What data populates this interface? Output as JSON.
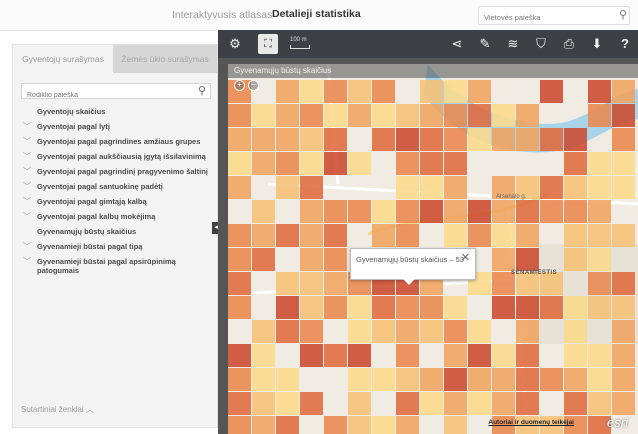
{
  "topbar": {
    "nav_atlas": "Interaktyvusis atlasas",
    "nav_stats": "Detalieji statistika",
    "search_placeholder": "Vietovės paieška"
  },
  "left_panel": {
    "tab_population": "Gyventojų surašymas",
    "tab_agriculture": "Žemės ūkio surašymas",
    "search_placeholder": "Rodiklio paieška",
    "items": [
      {
        "label": "Gyventojų skaičius",
        "expandable": false
      },
      {
        "label": "Gyventojai pagal lytį",
        "expandable": true
      },
      {
        "label": "Gyventojai pagal pagrindines amžiaus grupes",
        "expandable": true
      },
      {
        "label": "Gyventojai pagal aukščiausią įgytą išsilavinimą",
        "expandable": true
      },
      {
        "label": "Gyventojai pagal pagrindinį pragyvenimo šaltinį",
        "expandable": true
      },
      {
        "label": "Gyventojai pagal santuokinę padėtį",
        "expandable": true
      },
      {
        "label": "Gyventojai pagal gimtąją kalbą",
        "expandable": true
      },
      {
        "label": "Gyventojai pagal kalbų mokėjimą",
        "expandable": true
      },
      {
        "label": "Gyvenamųjų būstų skaičius",
        "expandable": false
      },
      {
        "label": "Gyvenamieji būstai pagal tipą",
        "expandable": true
      },
      {
        "label": "Gyvenamieji būstai pagal apsirūpinimą patogumais",
        "expandable": true
      }
    ],
    "legend_toggle": "Sutartiniai ženklai ︿"
  },
  "map": {
    "scale_label": "100 m",
    "layer_title": "Gyvenamųjų būstų skaičius",
    "popup_text": "Gyvenamųjų būstų skaičius – 53",
    "attribution": "Autoriai ir duomenų teikėjai",
    "esri_logo": "esri",
    "streets": [
      "Arsenalo g.",
      "SENAMIESTIS"
    ],
    "colors": {
      "toolbar": "#3d4145",
      "ramp": [
        "#fbd98a",
        "#f6c074",
        "#f0a35e",
        "#e9874d",
        "#df6a3d",
        "#cc4a2e"
      ]
    }
  },
  "icons": {
    "settings": "⚙",
    "fullscreen": "⛶",
    "share": "⋖",
    "draw": "✎",
    "layers": "≋",
    "basemap": "⛉",
    "print": "⎙",
    "download": "⬇",
    "help": "?",
    "search": "⚲",
    "close": "✕",
    "collapse": "◂"
  }
}
